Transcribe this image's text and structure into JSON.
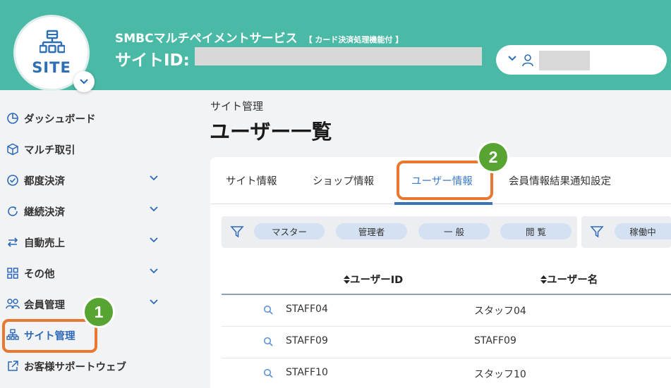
{
  "header": {
    "logo_text": "SITE",
    "company_name": "SMBCマルチペイメントサービス",
    "company_tag": "【 カード決済処理機能付 】",
    "site_id_label": "サイトID:"
  },
  "sidebar": {
    "items": [
      {
        "label": "ダッシュボード",
        "icon": "pie-chart-icon"
      },
      {
        "label": "マルチ取引",
        "icon": "cube-icon"
      },
      {
        "label": "都度決済",
        "icon": "check-circle-icon"
      },
      {
        "label": "継続決済",
        "icon": "refresh-icon"
      },
      {
        "label": "自動売上",
        "icon": "swap-icon"
      },
      {
        "label": "その他",
        "icon": "grid-icon"
      },
      {
        "label": "会員管理",
        "icon": "users-icon"
      },
      {
        "label": "サイト管理",
        "icon": "sitemap-icon"
      },
      {
        "label": "お客様サポートウェブ",
        "icon": "external-link-icon"
      }
    ]
  },
  "annotations": {
    "badge1": "1",
    "badge2": "2",
    "highlight_color": "#e8782f",
    "badge_color": "#57a432"
  },
  "main": {
    "breadcrumb": "サイト管理",
    "title": "ユーザー一覧",
    "tabs": [
      {
        "label": "サイト情報"
      },
      {
        "label": "ショップ情報"
      },
      {
        "label": "ユーザー情報"
      },
      {
        "label": "会員情報結果通知設定"
      }
    ],
    "role_filters": [
      "マスター",
      "管理者",
      "一 般",
      "閲 覧"
    ],
    "status_filters": [
      "稼働中"
    ],
    "columns": [
      "ユーザーID",
      "ユーザー名"
    ],
    "rows": [
      {
        "id": "STAFF04",
        "name": "スタッフ04"
      },
      {
        "id": "STAFF09",
        "name": "STAFF09"
      },
      {
        "id": "STAFF10",
        "name": "スタッフ10"
      }
    ]
  },
  "colors": {
    "header_bg": "#4ab9a6",
    "active_blue": "#3b7bd1",
    "chip_bg": "#d3e1f3"
  }
}
